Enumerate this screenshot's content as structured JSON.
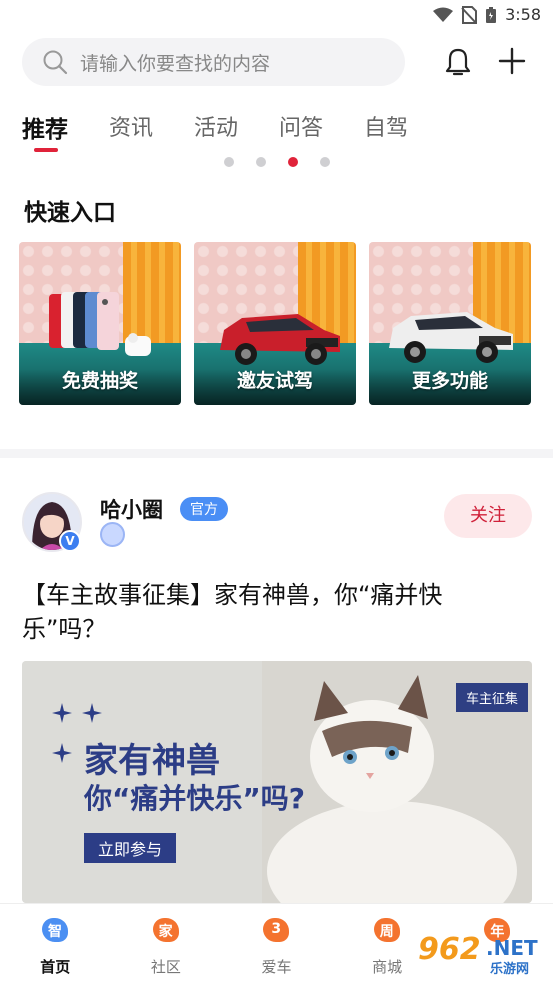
{
  "status_bar": {
    "time": "3:58",
    "icons": [
      "wifi-icon",
      "no-sim-icon",
      "battery-icon"
    ]
  },
  "search": {
    "placeholder": "请输入你要查找的内容"
  },
  "header_icons": [
    "bell-icon",
    "plus-icon"
  ],
  "tabs": [
    {
      "label": "推荐",
      "active": true
    },
    {
      "label": "资讯"
    },
    {
      "label": "活动"
    },
    {
      "label": "问答"
    },
    {
      "label": "自驾"
    }
  ],
  "carousel": {
    "dots": 4,
    "active_index": 2
  },
  "quick_entry": {
    "title": "快速入口",
    "items": [
      {
        "label": "免费抽奖"
      },
      {
        "label": "邀友试驾"
      },
      {
        "label": "更多功能"
      }
    ]
  },
  "post": {
    "username": "哈小圈",
    "official_badge": "官方",
    "verified_badge": "V",
    "follow_label": "关注",
    "title": "【车主故事征集】家有神兽，你“痛并快乐”吗？",
    "banner": {
      "tag": "车主征集",
      "headline": "家有神兽",
      "subline": "你“痛并快乐”吗?",
      "cta": "立即参与"
    }
  },
  "bottom_nav": [
    {
      "label": "首页",
      "glyph": "智",
      "active": true
    },
    {
      "label": "社区",
      "glyph": "家"
    },
    {
      "label": "爱车",
      "glyph": "3"
    },
    {
      "label": "商城",
      "glyph": "周"
    },
    {
      "label": "",
      "glyph": "年"
    }
  ],
  "watermark": {
    "number": "962",
    "suffix": ".NET",
    "site": "乐游网"
  },
  "colors": {
    "accent": "#e0233a",
    "official": "#4a8ef5",
    "banner_blue": "#2c3d86",
    "nav_orange": "#f4732f"
  }
}
